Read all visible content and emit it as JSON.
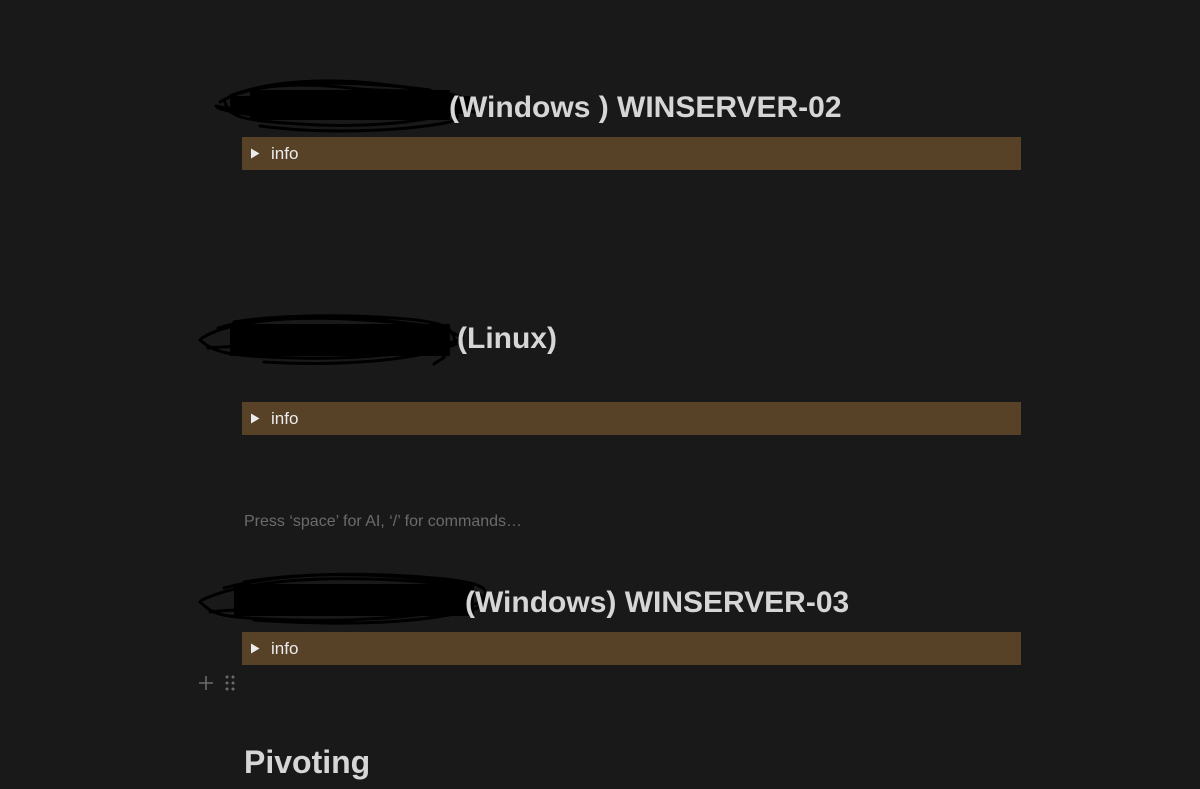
{
  "blocks": [
    {
      "heading": "(Windows ) WINSERVER-02",
      "toggle_label": "info"
    },
    {
      "heading": "(Linux)",
      "toggle_label": "info"
    },
    {
      "heading": "(Windows) WINSERVER-03",
      "toggle_label": "info"
    }
  ],
  "editor": {
    "placeholder": "Press ‘space’ for AI, ‘/’ for commands…"
  },
  "section": {
    "title": "Pivoting"
  },
  "colors": {
    "background": "#191919",
    "toggle_background": "#574228",
    "heading_text": "#d6d6d6",
    "placeholder_text": "#6b6b6b"
  },
  "icons": {
    "toggle": "triangle-right-icon",
    "add": "plus-icon",
    "drag": "drag-handle-icon",
    "redaction": "redaction-scribble"
  }
}
